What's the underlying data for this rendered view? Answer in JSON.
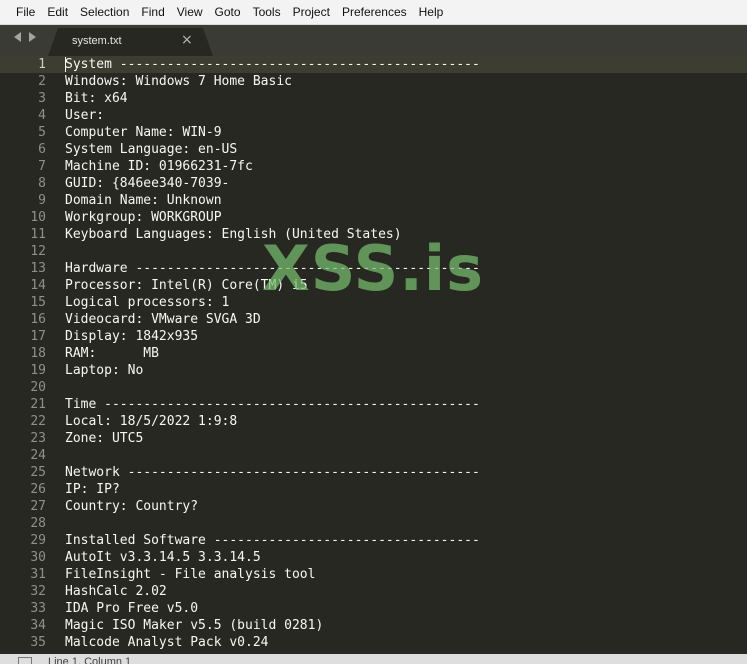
{
  "menu": [
    "File",
    "Edit",
    "Selection",
    "Find",
    "View",
    "Goto",
    "Tools",
    "Project",
    "Preferences",
    "Help"
  ],
  "tab": {
    "label": "system.txt",
    "close": "×"
  },
  "editor": {
    "current_line": 1,
    "lines": [
      "System ----------------------------------------------",
      "Windows: Windows 7 Home Basic",
      "Bit: x64",
      "User:",
      "Computer Name: WIN-9",
      "System Language: en-US",
      "Machine ID: 01966231-7fc",
      "GUID: {846ee340-7039-",
      "Domain Name: Unknown",
      "Workgroup: WORKGROUP",
      "Keyboard Languages: English (United States)",
      "",
      "Hardware --------------------------------------------",
      "Processor: Intel(R) Core(TM) i5",
      "Logical processors: 1",
      "Videocard: VMware SVGA 3D",
      "Display: 1842x935",
      "RAM:      MB",
      "Laptop: No",
      "",
      "Time ------------------------------------------------",
      "Local: 18/5/2022 1:9:8",
      "Zone: UTC5",
      "",
      "Network ---------------------------------------------",
      "IP: IP?",
      "Country: Country?",
      "",
      "Installed Software ----------------------------------",
      "AutoIt v3.3.14.5 3.3.14.5",
      "FileInsight - File analysis tool",
      "HashCalc 2.02",
      "IDA Pro Free v5.0",
      "Magic ISO Maker v5.5 (build 0281)",
      "Malcode Analyst Pack v0.24"
    ]
  },
  "watermark": "XSS.is",
  "status": {
    "text": "Line 1, Column 1"
  },
  "colors": {
    "background": "#272822",
    "text": "#f8f8f2",
    "gutter": "#90908a",
    "watermark": "#78be6e"
  }
}
